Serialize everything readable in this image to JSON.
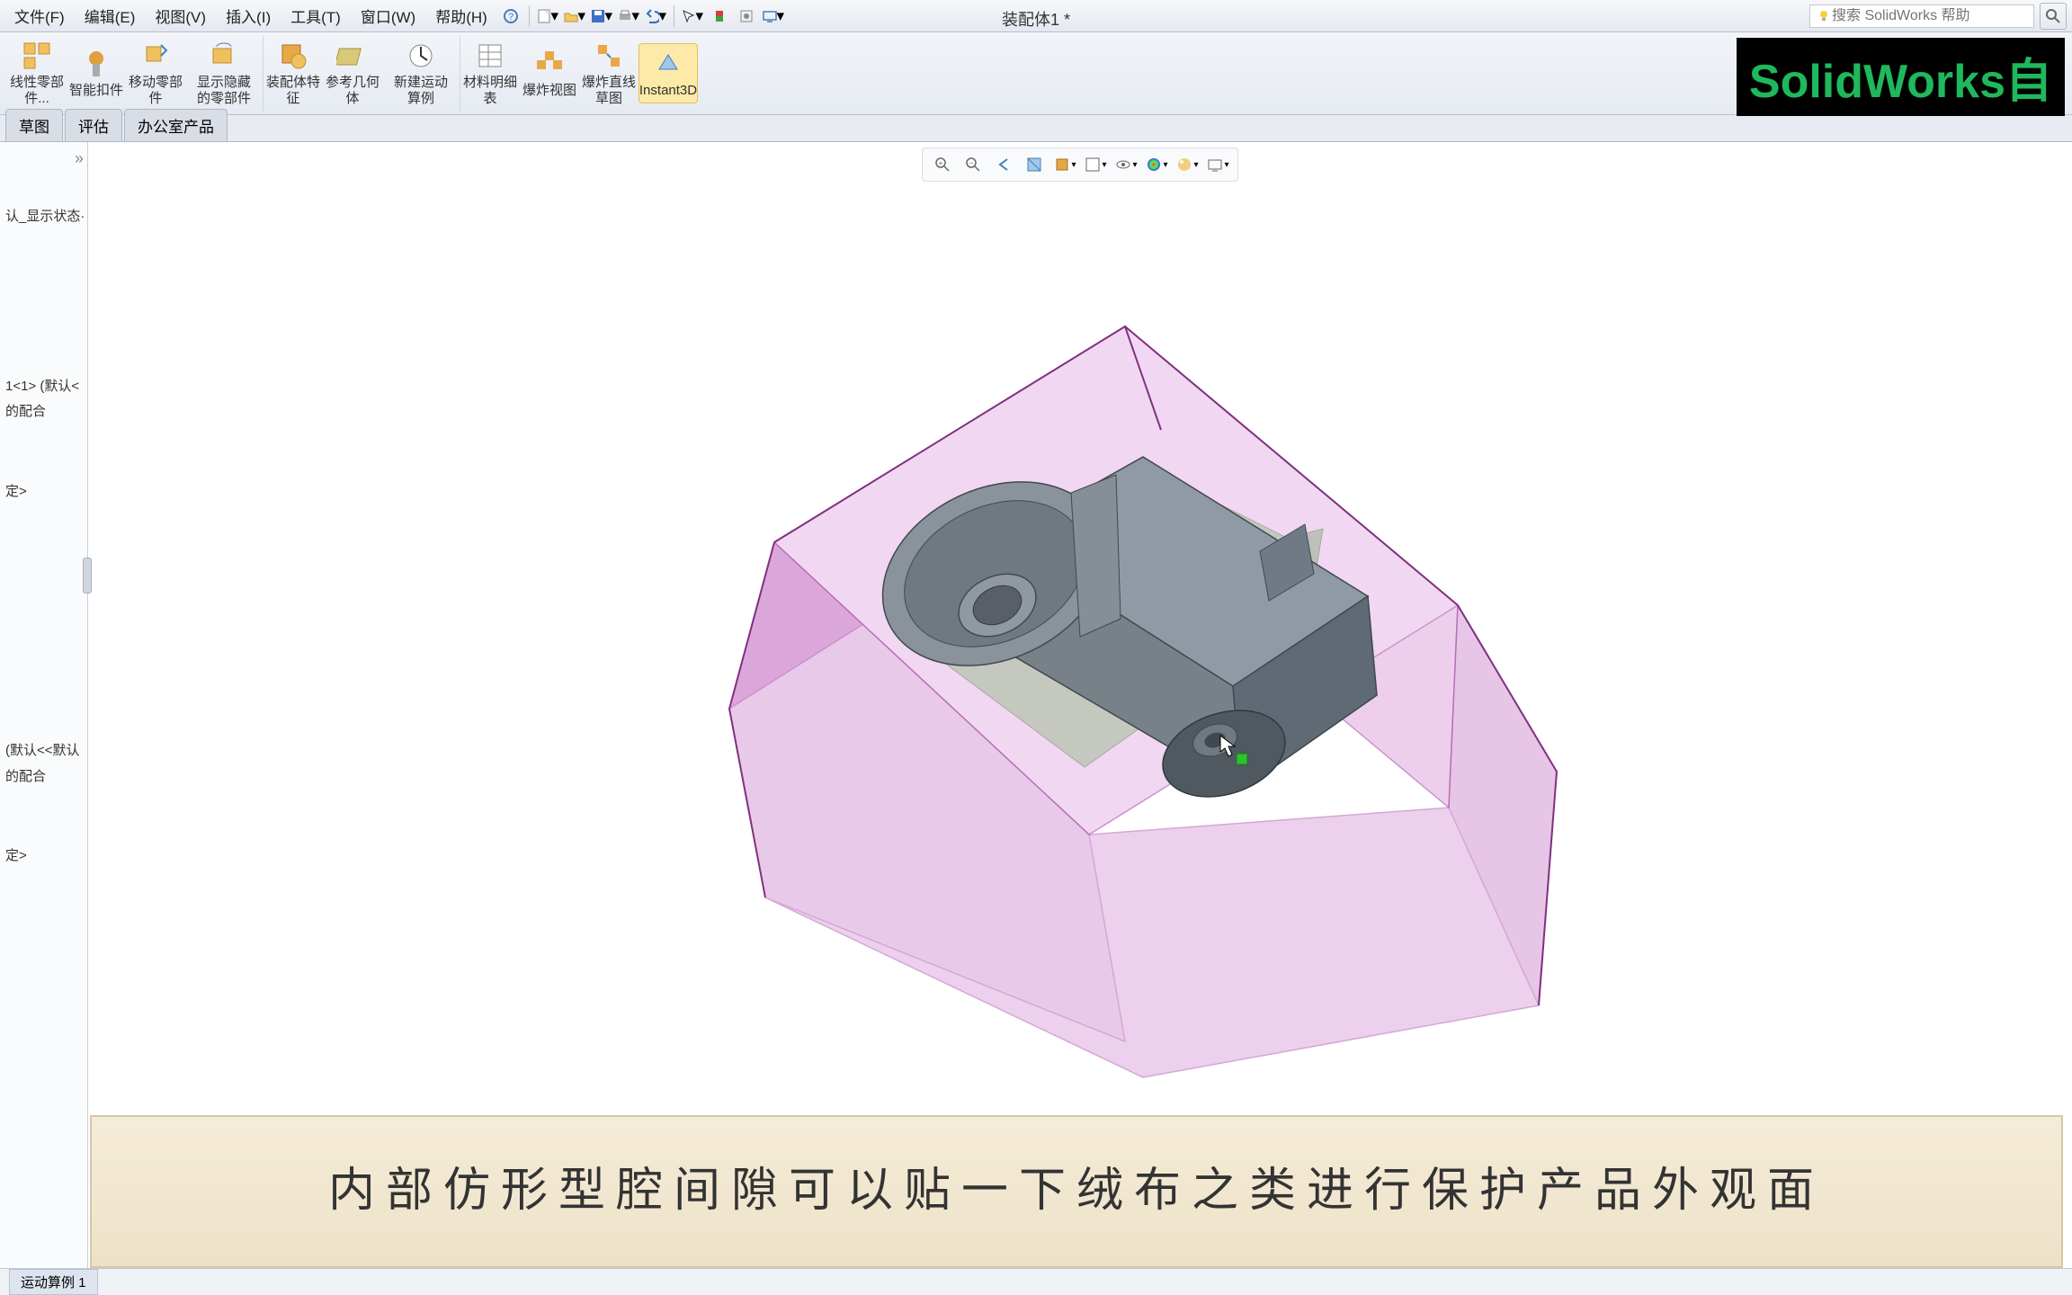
{
  "menu": {
    "file": "文件(F)",
    "edit": "编辑(E)",
    "view": "视图(V)",
    "insert": "插入(I)",
    "tools": "工具(T)",
    "window": "窗口(W)",
    "help": "帮助(H)"
  },
  "doc_title": "装配体1 *",
  "search_placeholder": "搜索 SolidWorks 帮助",
  "ribbon": {
    "btn1": "线性零部件...",
    "btn2": "智能扣件",
    "btn3": "移动零部件",
    "btn4": "显示隐藏的零部件",
    "btn5": "装配体特征",
    "btn6": "参考几何体",
    "btn7": "新建运动算例",
    "btn8": "材料明细表",
    "btn9": "爆炸视图",
    "btn10": "爆炸直线草图",
    "btn11": "Instant3D"
  },
  "tabs": {
    "t1": "草图",
    "t2": "评估",
    "t3": "办公室产品"
  },
  "tree": {
    "collapse": "»",
    "item1": "认_显示状态·",
    "item2": "1<1> (默认<",
    "item3": "的配合",
    "item4": "定>",
    "item5": "(默认<<默认",
    "item6": "的配合",
    "item7": "定>"
  },
  "subtitle": "内部仿形型腔间隙可以贴一下绒布之类进行保护产品外观面",
  "status": {
    "tab1": "运动算例 1"
  },
  "watermark": "SolidWorks自",
  "colors": {
    "model_purple": "#d088d0",
    "model_purple_dark": "#b060b0",
    "model_gray": "#808890",
    "model_gray_dark": "#505860",
    "model_green": "#7ea86e"
  }
}
